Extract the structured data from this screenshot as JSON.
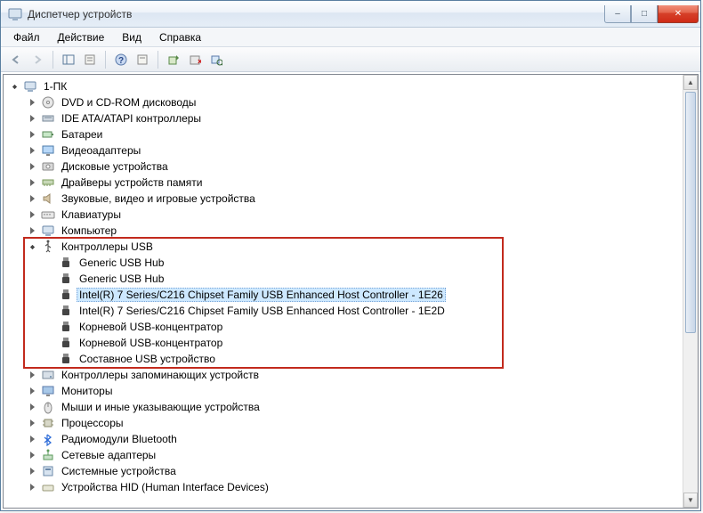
{
  "window": {
    "title": "Диспетчер устройств",
    "buttons": {
      "minimize": "–",
      "maximize": "□",
      "close": "✕"
    }
  },
  "menubar": [
    "Файл",
    "Действие",
    "Вид",
    "Справка"
  ],
  "tree": {
    "root": "1-ПК",
    "categories": [
      {
        "label": "DVD и CD-ROM дисководы",
        "icon": "disc"
      },
      {
        "label": "IDE ATA/ATAPI контроллеры",
        "icon": "ide"
      },
      {
        "label": "Батареи",
        "icon": "battery"
      },
      {
        "label": "Видеоадаптеры",
        "icon": "display"
      },
      {
        "label": "Дисковые устройства",
        "icon": "disk"
      },
      {
        "label": "Драйверы устройств памяти",
        "icon": "memory"
      },
      {
        "label": "Звуковые, видео и игровые устройства",
        "icon": "sound"
      },
      {
        "label": "Клавиатуры",
        "icon": "keyboard"
      },
      {
        "label": "Компьютер",
        "icon": "computer"
      }
    ],
    "usb": {
      "label": "Контроллеры USB",
      "children": [
        "Generic USB Hub",
        "Generic USB Hub",
        "Intel(R) 7 Series/C216 Chipset Family USB Enhanced Host Controller - 1E26",
        "Intel(R) 7 Series/C216 Chipset Family USB Enhanced Host Controller - 1E2D",
        "Корневой USB-концентратор",
        "Корневой USB-концентратор",
        "Составное USB устройство"
      ],
      "selected_index": 2
    },
    "categories2": [
      {
        "label": "Контроллеры запоминающих устройств",
        "icon": "storage"
      },
      {
        "label": "Мониторы",
        "icon": "monitor"
      },
      {
        "label": "Мыши и иные указывающие устройства",
        "icon": "mouse"
      },
      {
        "label": "Процессоры",
        "icon": "cpu"
      },
      {
        "label": "Радиомодули Bluetooth",
        "icon": "bluetooth"
      },
      {
        "label": "Сетевые адаптеры",
        "icon": "network"
      },
      {
        "label": "Системные устройства",
        "icon": "system"
      },
      {
        "label": "Устройства HID (Human Interface Devices)",
        "icon": "hid"
      }
    ]
  }
}
